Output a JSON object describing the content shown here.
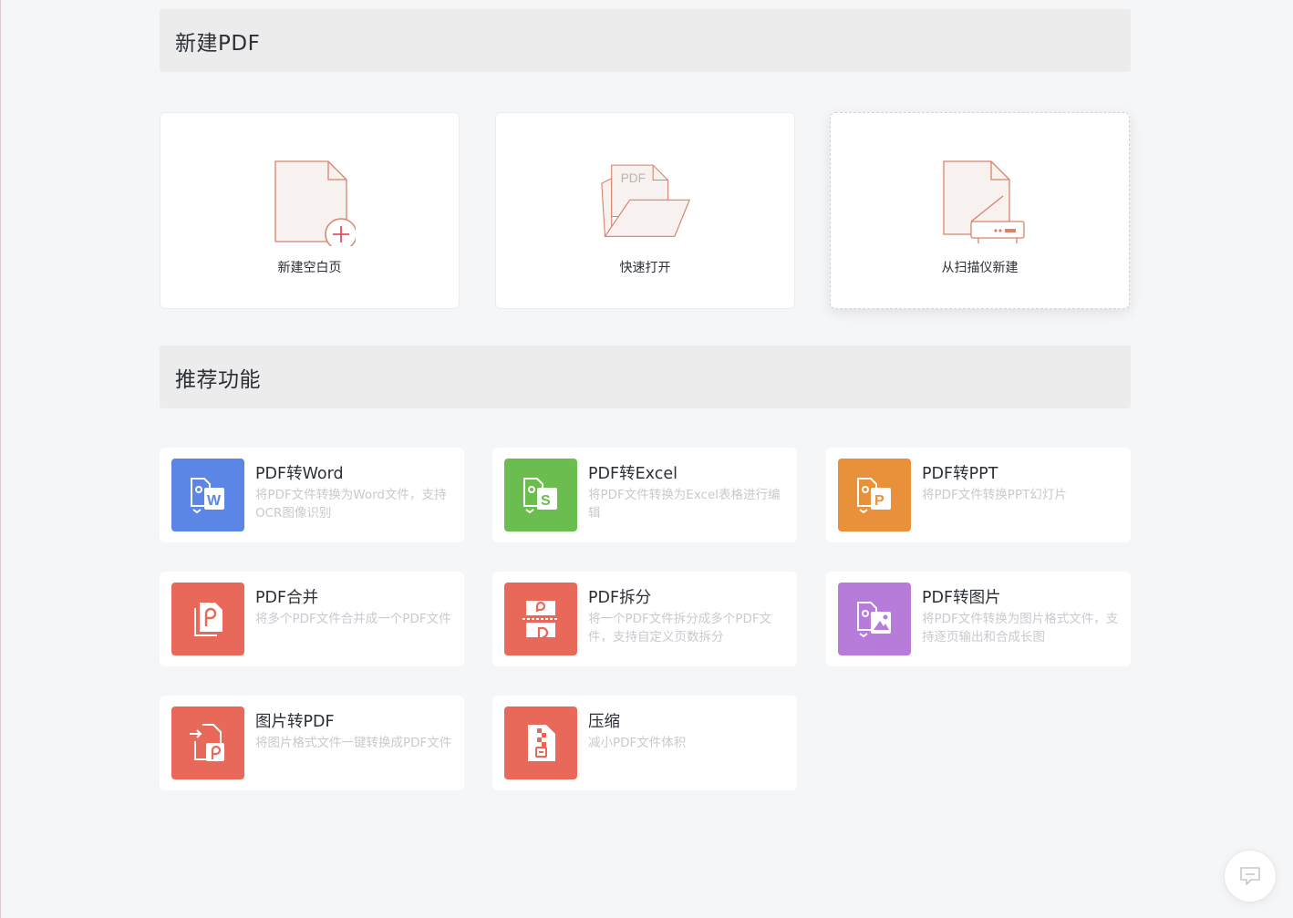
{
  "sections": {
    "new_pdf": "新建PDF",
    "recommended": "推荐功能"
  },
  "new_cards": [
    {
      "label": "新建空白页",
      "icon": "blank-page-plus-icon"
    },
    {
      "label": "快速打开",
      "icon": "pdf-folder-open-icon",
      "art_text": "PDF"
    },
    {
      "label": "从扫描仪新建",
      "icon": "scanner-page-icon"
    }
  ],
  "features": [
    {
      "title": "PDF转Word",
      "desc": "将PDF文件转换为Word文件，支持OCR图像识别",
      "color": "#5b86e5",
      "icon": "pdf-to-word-icon",
      "glyph": "W"
    },
    {
      "title": "PDF转Excel",
      "desc": "将PDF文件转换为Excel表格进行编辑",
      "color": "#6cbd4f",
      "icon": "pdf-to-excel-icon",
      "glyph": "S"
    },
    {
      "title": "PDF转PPT",
      "desc": "将PDF文件转换PPT幻灯片",
      "color": "#e8903a",
      "icon": "pdf-to-ppt-icon",
      "glyph": "P"
    },
    {
      "title": "PDF合并",
      "desc": "将多个PDF文件合并成一个PDF文件",
      "color": "#e8685a",
      "icon": "pdf-merge-icon"
    },
    {
      "title": "PDF拆分",
      "desc": "将一个PDF文件拆分成多个PDF文件，支持自定义页数拆分",
      "color": "#e8685a",
      "icon": "pdf-split-icon"
    },
    {
      "title": "PDF转图片",
      "desc": "将PDF文件转换为图片格式文件，支持逐页输出和合成长图",
      "color": "#b77bd9",
      "icon": "pdf-to-image-icon"
    },
    {
      "title": "图片转PDF",
      "desc": "将图片格式文件一键转换成PDF文件",
      "color": "#e8685a",
      "icon": "image-to-pdf-icon"
    },
    {
      "title": "压缩",
      "desc": "减小PDF文件体积",
      "color": "#e8685a",
      "icon": "compress-icon"
    }
  ],
  "colors": {
    "line_art": "#d9826c",
    "page_fill": "#f7f1f0",
    "background": "#f5f6f8",
    "header_bg": "#ececed"
  },
  "chat": {
    "icon": "chat-bubble-icon"
  }
}
